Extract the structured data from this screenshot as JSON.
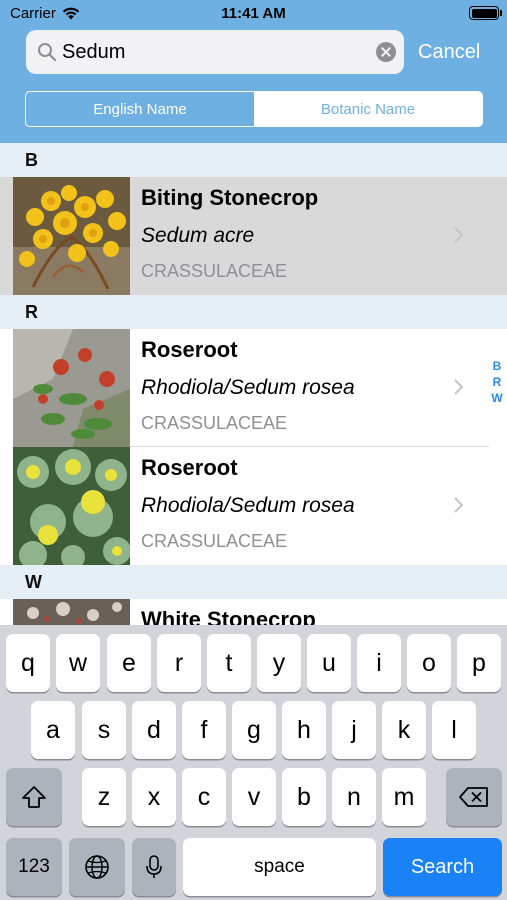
{
  "status_bar": {
    "carrier": "Carrier",
    "time": "11:41 AM"
  },
  "search": {
    "query": "Sedum",
    "cancel_label": "Cancel"
  },
  "segmented": {
    "english": "English Name",
    "botanic": "Botanic Name",
    "selected": "English Name"
  },
  "sections": [
    {
      "letter": "B",
      "rows": [
        {
          "title": "Biting Stonecrop",
          "latin": "Sedum acre",
          "family": "CRASSULACEAE",
          "selected": true
        }
      ]
    },
    {
      "letter": "R",
      "rows": [
        {
          "title": "Roseroot",
          "latin": "Rhodiola/Sedum rosea",
          "family": "CRASSULACEAE"
        },
        {
          "title": "Roseroot",
          "latin": "Rhodiola/Sedum rosea",
          "family": "CRASSULACEAE"
        }
      ]
    },
    {
      "letter": "W",
      "rows": [
        {
          "title": "White Stonecrop"
        }
      ]
    }
  ],
  "index": [
    "B",
    "R",
    "W"
  ],
  "keyboard": {
    "row1": [
      "q",
      "w",
      "e",
      "r",
      "t",
      "y",
      "u",
      "i",
      "o",
      "p"
    ],
    "row2": [
      "a",
      "s",
      "d",
      "f",
      "g",
      "h",
      "j",
      "k",
      "l"
    ],
    "row3": [
      "z",
      "x",
      "c",
      "v",
      "b",
      "n",
      "m"
    ],
    "numbers_label": "123",
    "space_label": "space",
    "search_label": "Search"
  },
  "colors": {
    "accent": "#6fb0e3",
    "search_key": "#1a82f6",
    "index": "#2b8cf0"
  }
}
